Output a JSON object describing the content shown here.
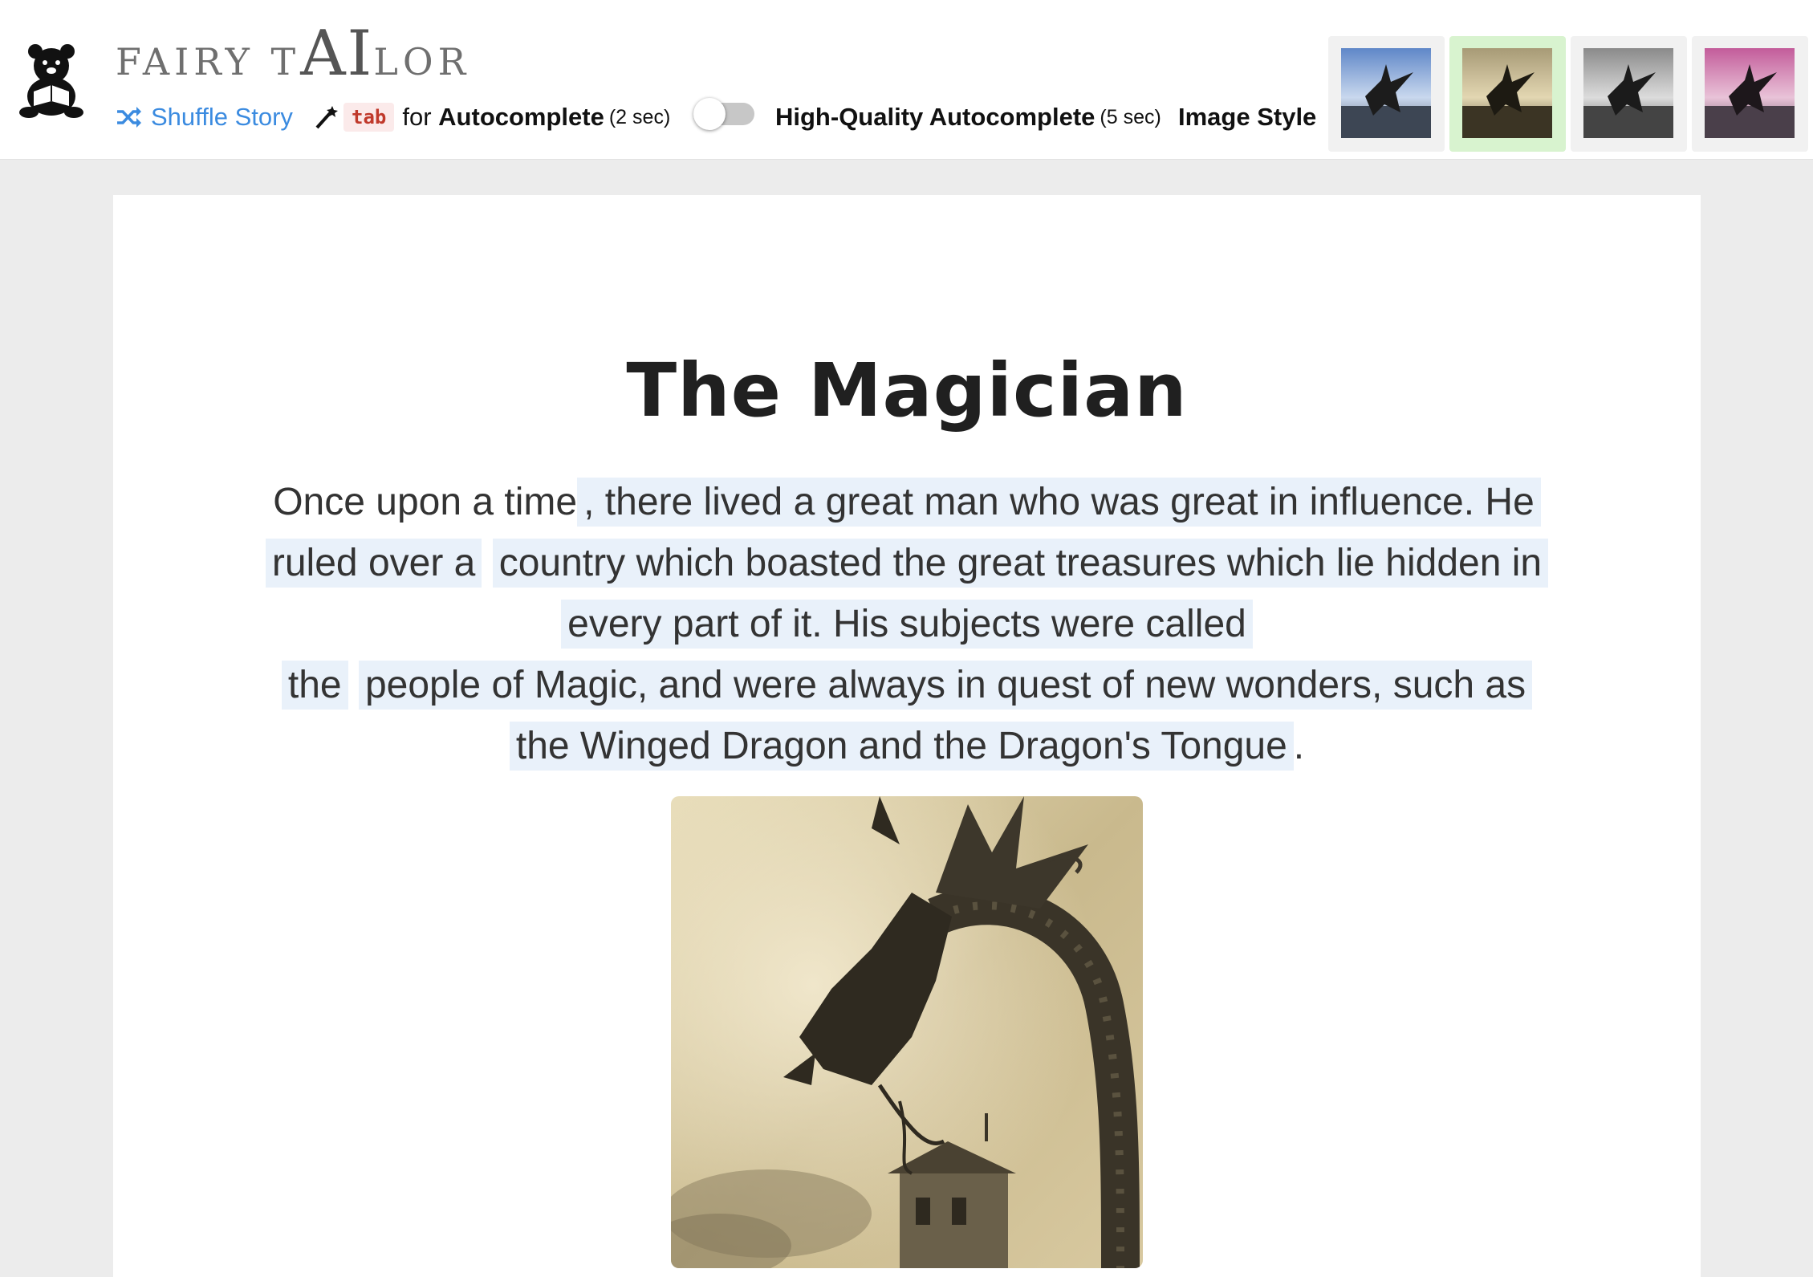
{
  "app": {
    "brand_prefix": "FAIRY T",
    "brand_ai": "AI",
    "brand_suffix": "LOR"
  },
  "toolbar": {
    "shuffle_label": "Shuffle Story",
    "tab_key": "tab",
    "autocomplete_prefix": "for",
    "autocomplete_label": "Autocomplete",
    "autocomplete_time": "(2 sec)",
    "hq_label": "High-Quality Autocomplete",
    "hq_time": "(5 sec)",
    "hq_enabled": false,
    "image_style_label": "Image Style",
    "image_styles": [
      {
        "icon": "dragon-thumb-color",
        "selected": false
      },
      {
        "icon": "dragon-thumb-sepia",
        "selected": true
      },
      {
        "icon": "dragon-thumb-grayscale",
        "selected": false
      },
      {
        "icon": "dragon-thumb-pink",
        "selected": false
      }
    ]
  },
  "story": {
    "title": "The Magician",
    "lines": [
      [
        "Once upon a time",
        ", there lived a great man who was great in influence. He"
      ],
      [
        "ruled over a",
        "country which boasted the great treasures which lie hidden in"
      ],
      [
        "",
        "every part of it. His subjects were called"
      ],
      [
        "the",
        "people of Magic, and were always in quest of new wonders, such as"
      ],
      [
        "the Winged Dragon and the Dragon's Tongue",
        "."
      ]
    ],
    "image_icon": "dragon-illustration-sepia"
  },
  "colors": {
    "accent": "#3b8be0",
    "selected_style": "#d8f3cf",
    "highlight": "#e9f1fa",
    "kbd_text": "#c0392b"
  }
}
